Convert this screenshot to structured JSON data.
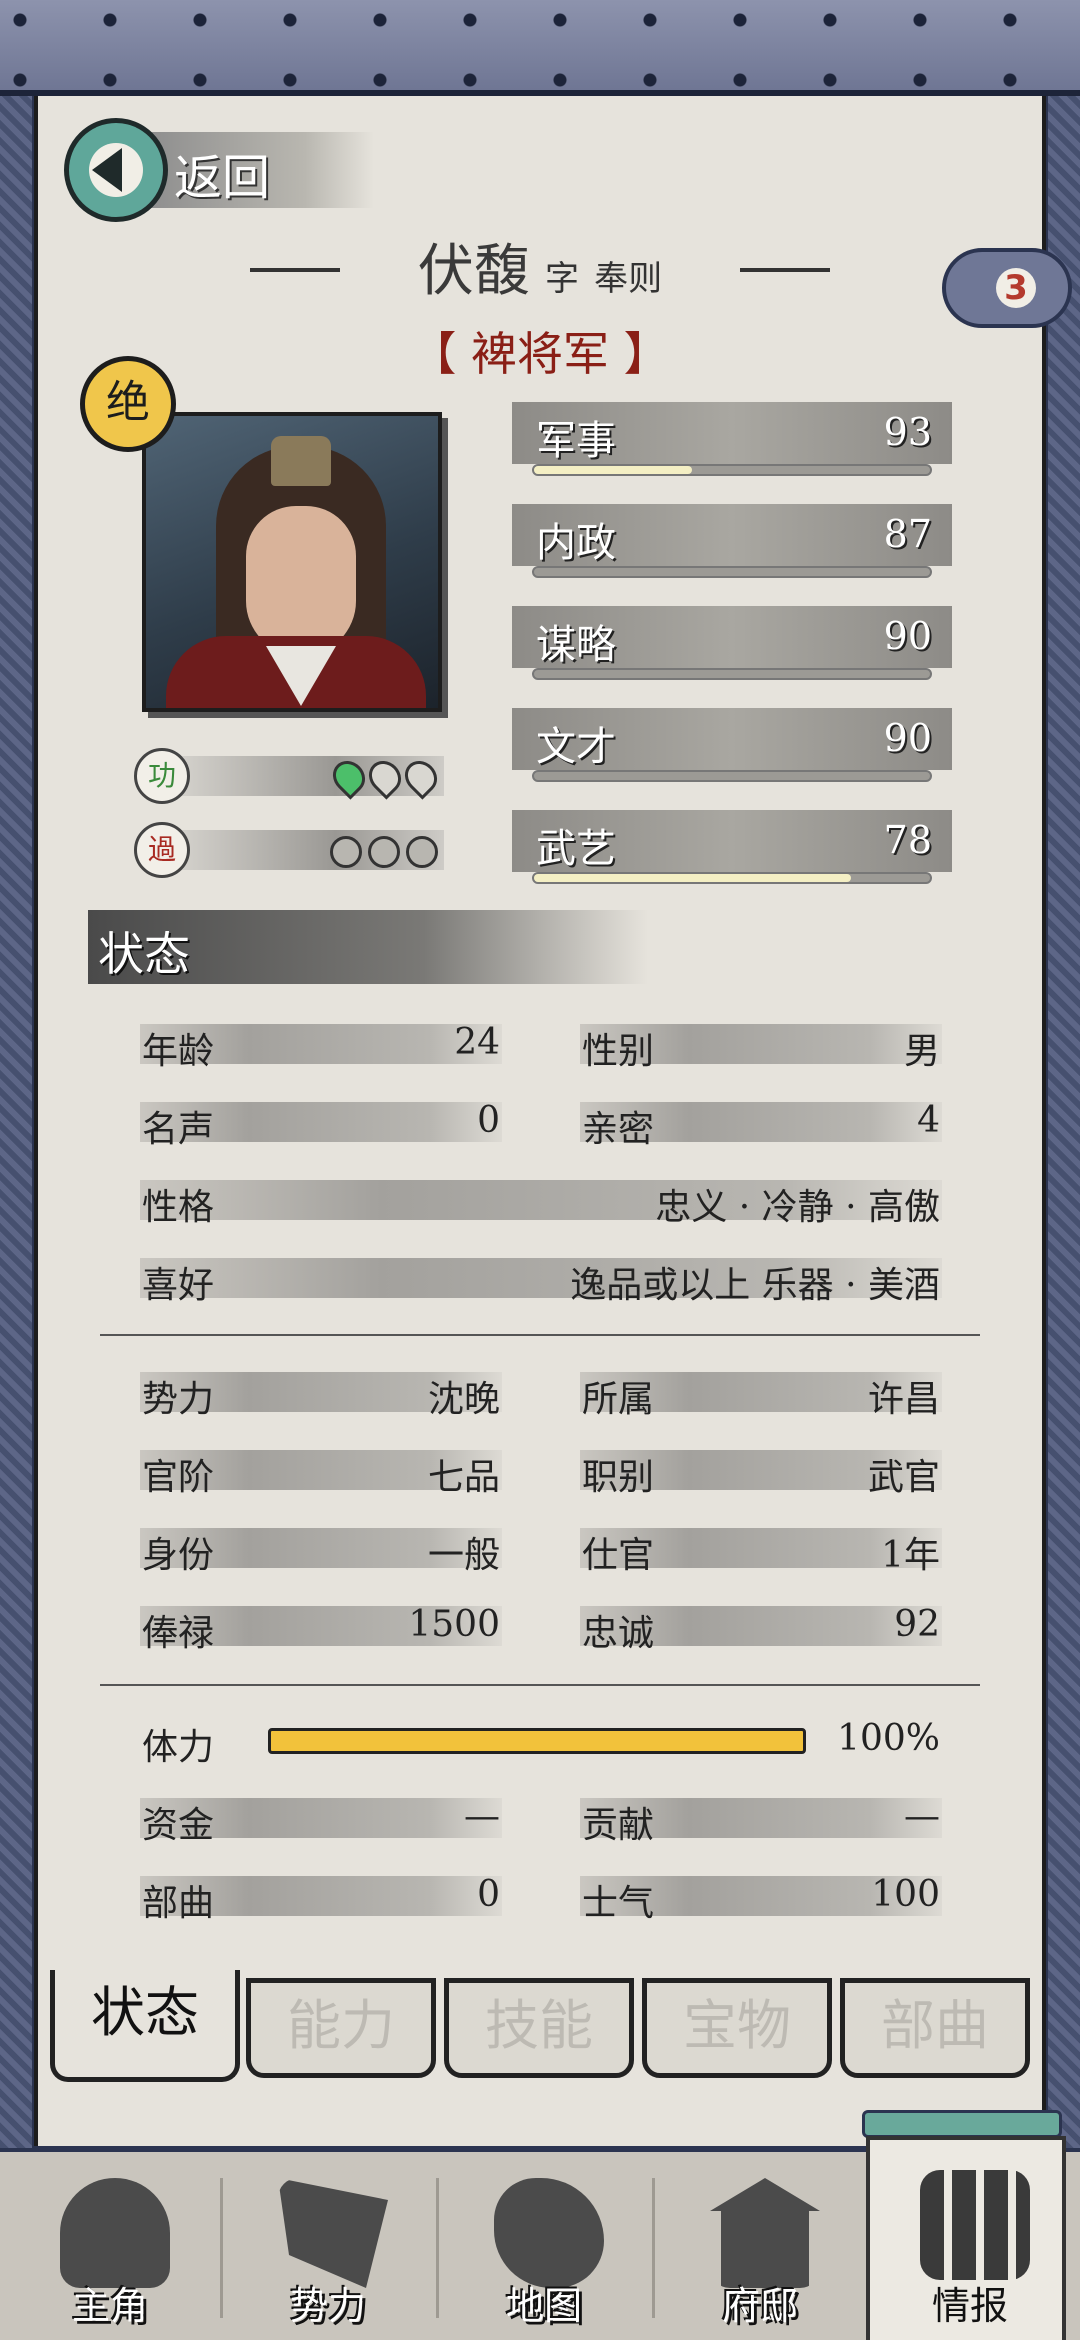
{
  "header": {
    "back_label": "返回"
  },
  "character": {
    "name": "伏馥",
    "zi_label": "字",
    "courtesy_name": "奉则",
    "title": "【 裨将军 】",
    "grade_badge": "绝",
    "merit_badge": "功",
    "fault_badge": "過",
    "cloud_count": "3"
  },
  "abilities": [
    {
      "label": "军事",
      "value": "93",
      "fill": 0.4
    },
    {
      "label": "内政",
      "value": "87",
      "fill": 0
    },
    {
      "label": "谋略",
      "value": "90",
      "fill": 0
    },
    {
      "label": "文才",
      "value": "90",
      "fill": 0
    },
    {
      "label": "武艺",
      "value": "78",
      "fill": 0.8
    }
  ],
  "status_section": {
    "title": "状态"
  },
  "status": {
    "age_label": "年龄",
    "age": "24",
    "gender_label": "性别",
    "gender": "男",
    "fame_label": "名声",
    "fame": "0",
    "intimacy_label": "亲密",
    "intimacy": "4",
    "personality_label": "性格",
    "personality": "忠义 · 冷静 · 高傲",
    "hobby_label": "喜好",
    "hobby": "逸品或以上  乐器 · 美酒",
    "faction_label": "势力",
    "faction": "沈晚",
    "belong_label": "所属",
    "belong": "许昌",
    "rank_label": "官阶",
    "rank": "七品",
    "post_label": "职别",
    "post": "武官",
    "identity_label": "身份",
    "identity": "一般",
    "service_label": "仕官",
    "service": "1年",
    "salary_label": "俸禄",
    "salary": "1500",
    "loyalty_label": "忠诚",
    "loyalty": "92",
    "stamina_label": "体力",
    "stamina": "100%",
    "funds_label": "资金",
    "funds": "—",
    "contribution_label": "贡献",
    "contribution": "—",
    "troops_label": "部曲",
    "troops": "0",
    "morale_label": "士气",
    "morale": "100"
  },
  "tabs": [
    "状态",
    "能力",
    "技能",
    "宝物",
    "部曲"
  ],
  "nav": [
    "主角",
    "势力",
    "地图",
    "府邸",
    "情报"
  ],
  "colors": {
    "accent": "#f2c23b",
    "title_red": "#8a1f16",
    "frame": "#2b3450"
  }
}
